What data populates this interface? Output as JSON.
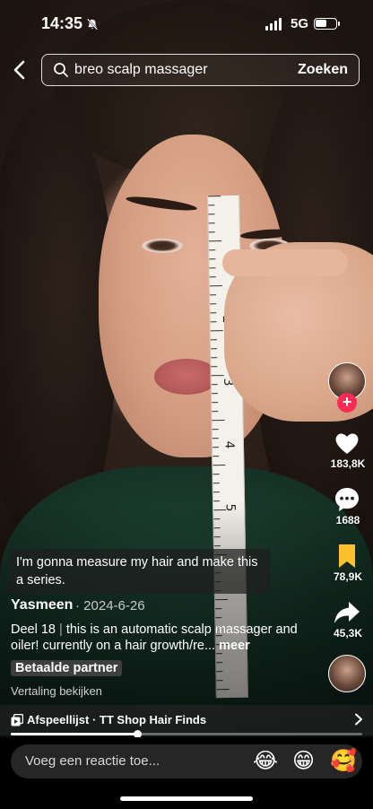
{
  "status_bar": {
    "time": "14:35",
    "network": "5G",
    "battery_level": 0.55
  },
  "search": {
    "query": "breo scalp massager",
    "submit_label": "Zoeken"
  },
  "video": {
    "tape_numbers": [
      "2",
      "3",
      "4",
      "5"
    ],
    "overlay_caption": "I'm gonna measure my hair and make this a series.",
    "progress": 0.36
  },
  "rail": {
    "like_count": "183,8K",
    "comment_count": "1688",
    "save_count": "78,9K",
    "share_count": "45,3K"
  },
  "post": {
    "author": "Yasmeen",
    "date": "· 2024-6-26",
    "description_prefix": "Deel 18",
    "description_separator": "|",
    "description": "this is an automatic scalp massager and oiler! currently on a hair growth/re...",
    "more_label": "meer",
    "partner_label": "Betaalde partner",
    "translate_label": "Vertaling bekijken"
  },
  "playlist": {
    "label": "Afspeellijst · TT Shop Hair Finds"
  },
  "comment_bar": {
    "placeholder": "Voeg een reactie toe...",
    "emojis": [
      "😂",
      "😁",
      "🥰"
    ]
  }
}
